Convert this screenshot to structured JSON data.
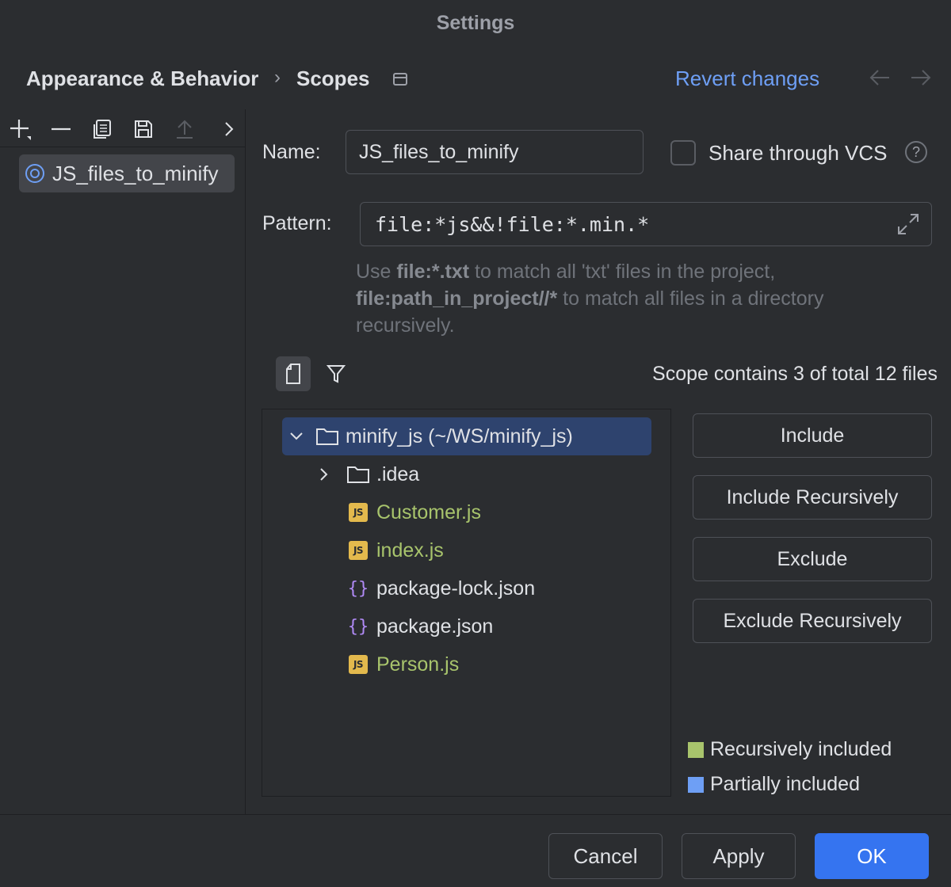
{
  "window": {
    "title": "Settings"
  },
  "breadcrumb": {
    "parent": "Appearance & Behavior",
    "separator": "›",
    "current": "Scopes"
  },
  "header": {
    "revert_label": "Revert changes"
  },
  "left_toolbar": {
    "icons": [
      "add-icon",
      "remove-icon",
      "copy-icon",
      "save-icon",
      "move-up-icon",
      "more-icon"
    ]
  },
  "scopes": [
    {
      "label": "JS_files_to_minify",
      "selected": true
    }
  ],
  "form": {
    "name_label": "Name:",
    "name_value": "JS_files_to_minify",
    "vcs_label": "Share through VCS",
    "vcs_checked": false,
    "help_glyph": "?",
    "pattern_label": "Pattern:",
    "pattern_value": "file:*js&&!file:*.min.*",
    "hint": {
      "part1": "Use ",
      "code1": "file:*.txt",
      "part2": " to match all 'txt' files in the project, ",
      "code2": "file:path_in_project//*",
      "part3": " to match all files in a directory recursively."
    }
  },
  "tree_toolbar": {
    "scope_count": "Scope contains 3 of total 12 files"
  },
  "tree": {
    "root": {
      "label": "minify_js (~/WS/minify_js)",
      "expanded": true
    },
    "items": [
      {
        "label": ".idea",
        "type": "folder",
        "badge": ""
      },
      {
        "label": "Customer.js",
        "type": "js",
        "badge": "JS"
      },
      {
        "label": "index.js",
        "type": "js",
        "badge": "JS"
      },
      {
        "label": "package-lock.json",
        "type": "json",
        "badge": "{}"
      },
      {
        "label": "package.json",
        "type": "json",
        "badge": "{}"
      },
      {
        "label": "Person.js",
        "type": "js",
        "badge": "JS"
      }
    ]
  },
  "side_buttons": {
    "include": "Include",
    "include_recursively": "Include Recursively",
    "exclude": "Exclude",
    "exclude_recursively": "Exclude Recursively"
  },
  "legend": {
    "recursive": {
      "label": "Recursively included",
      "color": "#a8c46c"
    },
    "partial": {
      "label": "Partially included",
      "color": "#6e9ff5"
    }
  },
  "footer": {
    "cancel": "Cancel",
    "apply": "Apply",
    "ok": "OK"
  },
  "colors": {
    "accent": "#3574f0",
    "link": "#6e9ff5",
    "js_included": "#a8c46c",
    "selection": "#2e436e"
  }
}
